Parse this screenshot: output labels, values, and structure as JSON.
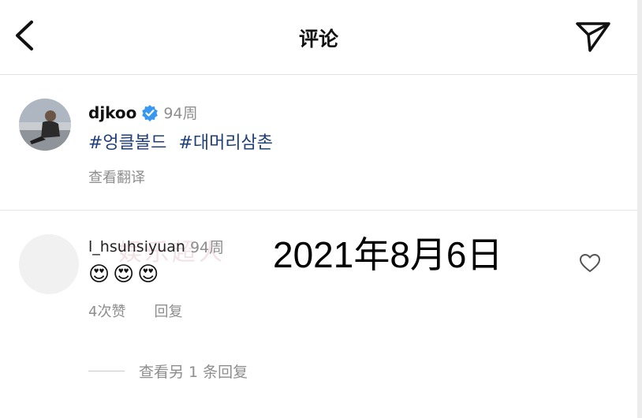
{
  "header": {
    "title": "评论"
  },
  "post": {
    "username": "djkoo",
    "time": "94周",
    "hashtags": [
      "#엉클볼드",
      "#대머리삼촌"
    ],
    "translate_label": "查看翻译"
  },
  "comment": {
    "username": "l_hsuhsiyuan",
    "time": "94周",
    "watermark": "娱乐超人",
    "emojis": [
      "😍",
      "😍",
      "😍"
    ],
    "likes_label": "4次赞",
    "reply_label": "回复",
    "view_replies_label": "查看另 1 条回复"
  },
  "overlay": {
    "date_text": "2021年8月6日"
  },
  "colors": {
    "hashtag": "#1f3f7a",
    "verified": "#3897f0",
    "meta": "#8e8e8e"
  }
}
